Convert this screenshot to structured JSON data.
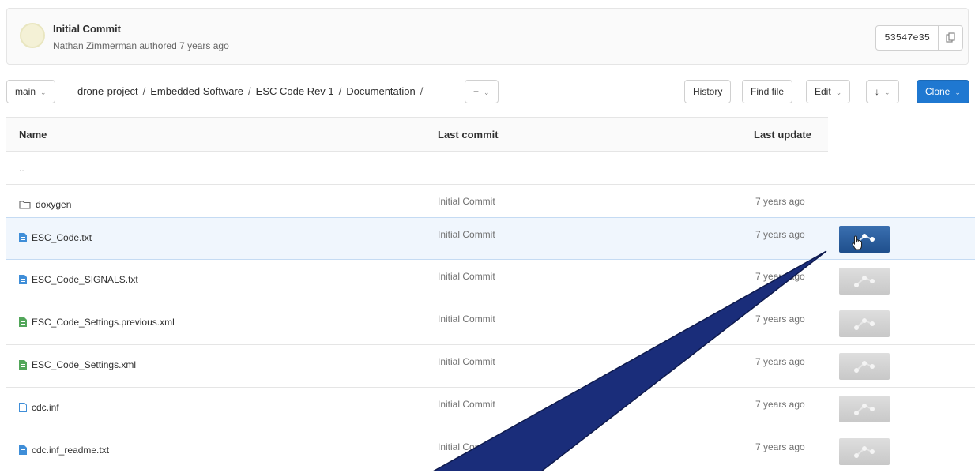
{
  "commit": {
    "title": "Initial Commit",
    "meta": "Nathan Zimmerman authored 7 years ago",
    "sha": "53547e35"
  },
  "toolbar": {
    "branch": "main",
    "breadcrumb": [
      "drone-project",
      "Embedded Software",
      "ESC Code Rev 1",
      "Documentation"
    ],
    "add_label": "+",
    "history_label": "History",
    "find_file_label": "Find file",
    "edit_label": "Edit",
    "download_icon": "↓",
    "clone_label": "Clone"
  },
  "table": {
    "headers": {
      "name": "Name",
      "last_commit": "Last commit",
      "last_update": "Last update"
    },
    "parent": "..",
    "rows": [
      {
        "name": "doxygen",
        "type": "folder",
        "commit": "Initial Commit",
        "updated": "7 years ago"
      },
      {
        "name": "ESC_Code.txt",
        "type": "file-blue",
        "commit": "Initial Commit",
        "updated": "7 years ago"
      },
      {
        "name": "ESC_Code_SIGNALS.txt",
        "type": "file-blue",
        "commit": "Initial Commit",
        "updated": "7 years ago"
      },
      {
        "name": "ESC_Code_Settings.previous.xml",
        "type": "file-green",
        "commit": "Initial Commit",
        "updated": "7 years ago"
      },
      {
        "name": "ESC_Code_Settings.xml",
        "type": "file-green",
        "commit": "Initial Commit",
        "updated": "7 years ago"
      },
      {
        "name": "cdc.inf",
        "type": "file-outline",
        "commit": "Initial Commit",
        "updated": "7 years ago"
      },
      {
        "name": "cdc.inf_readme.txt",
        "type": "file-blue",
        "commit": "Initial Commit",
        "updated": "7 years ago"
      }
    ]
  },
  "colors": {
    "primary": "#1f78d1",
    "highlight": "#f0f6fd",
    "callout": "#1a2d7a"
  }
}
